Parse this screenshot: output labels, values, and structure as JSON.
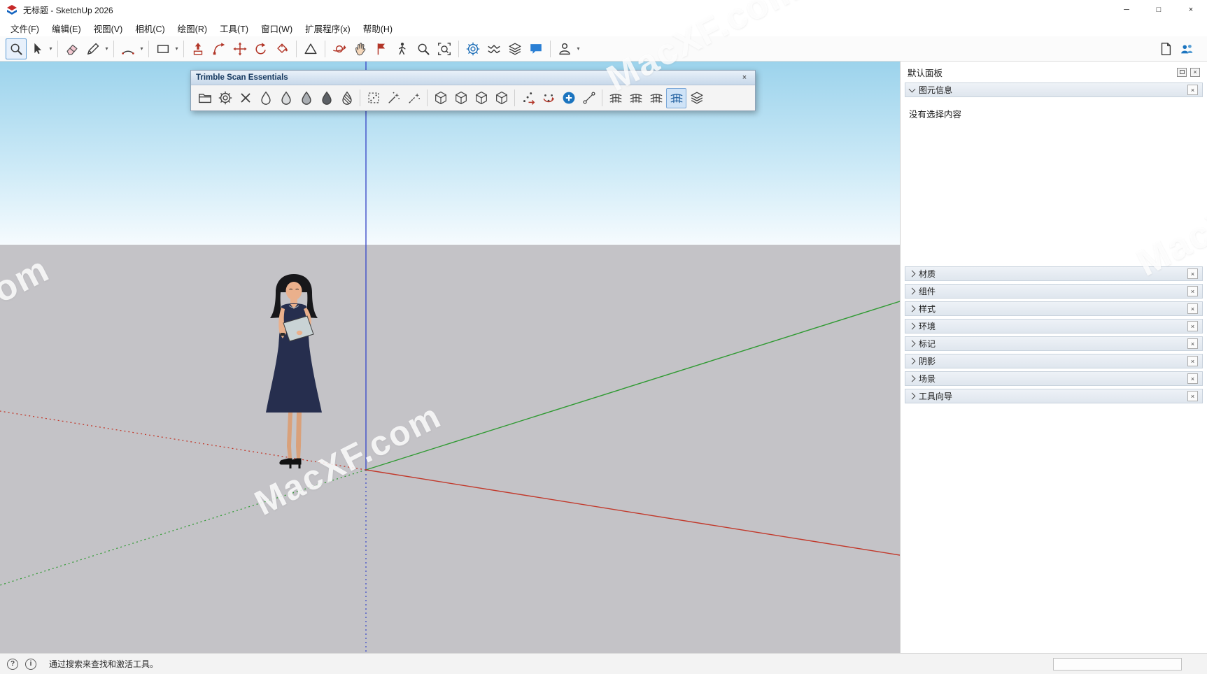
{
  "window": {
    "title": "无标题 - SketchUp 2026"
  },
  "ui": {
    "caret": "▾",
    "close_glyph": "×",
    "min_glyph": "─",
    "max_glyph": "□",
    "help_glyph": "?",
    "info_glyph": "i"
  },
  "menu": {
    "items": [
      "文件(F)",
      "编辑(E)",
      "视图(V)",
      "相机(C)",
      "绘图(R)",
      "工具(T)",
      "窗口(W)",
      "扩展程序(x)",
      "帮助(H)"
    ]
  },
  "float_toolbar": {
    "title": "Trimble Scan Essentials"
  },
  "panel": {
    "title": "默认面板",
    "entity_info": {
      "label": "图元信息",
      "empty_message": "没有选择内容"
    },
    "sections": [
      {
        "label": "材质"
      },
      {
        "label": "组件"
      },
      {
        "label": "样式"
      },
      {
        "label": "环境"
      },
      {
        "label": "标记"
      },
      {
        "label": "阴影"
      },
      {
        "label": "场景"
      },
      {
        "label": "工具向导"
      }
    ]
  },
  "statusbar": {
    "hint": "通过搜索来查找和激活工具。",
    "measurement_value": ""
  },
  "watermark": {
    "text": "MacXF.com"
  },
  "colors": {
    "sky_top": "#9cd3ec",
    "ground": "#c4c3c7",
    "axis_red": "#c2392b",
    "axis_green": "#2f9a32",
    "axis_blue": "#3f4ec8",
    "accent_blue": "#1e6fb8"
  }
}
